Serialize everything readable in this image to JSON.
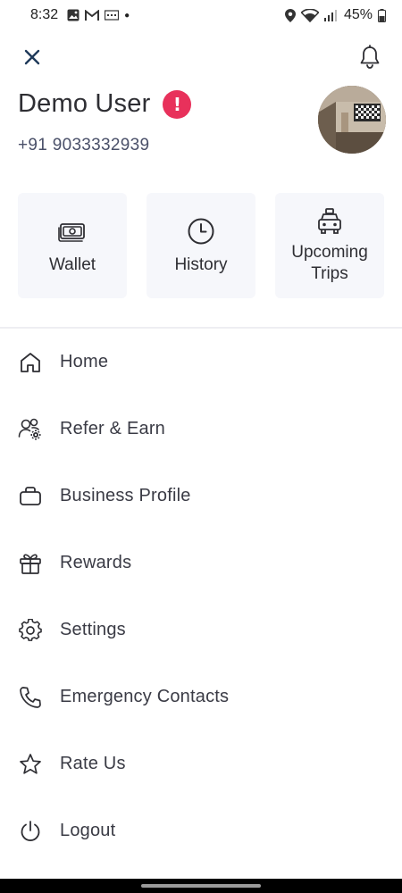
{
  "status_bar": {
    "time": "8:32",
    "battery": "45%",
    "left_icons": [
      "image-icon",
      "gmail-icon",
      "sms-icon",
      "notification-dot"
    ],
    "right_icons": [
      "location-icon",
      "wifi-icon",
      "signal-icon",
      "battery-icon"
    ]
  },
  "header": {
    "close_icon": "close-icon",
    "bell_icon": "bell-icon"
  },
  "profile": {
    "name": "Demo User",
    "alert_symbol": "!",
    "phone": "+91 9033332939",
    "alert_color": "#e8315b"
  },
  "cards": [
    {
      "label": "Wallet",
      "icon": "wallet-icon"
    },
    {
      "label": "History",
      "icon": "clock-icon"
    },
    {
      "label": "Upcoming Trips",
      "icon": "taxi-icon"
    }
  ],
  "menu": {
    "items": [
      {
        "label": "Home",
        "icon": "home-icon"
      },
      {
        "label": "Refer & Earn",
        "icon": "refer-icon"
      },
      {
        "label": "Business Profile",
        "icon": "briefcase-icon"
      },
      {
        "label": "Rewards",
        "icon": "gift-icon"
      },
      {
        "label": "Settings",
        "icon": "gear-icon"
      },
      {
        "label": "Emergency Contacts",
        "icon": "phone-icon"
      },
      {
        "label": "Rate Us",
        "icon": "star-icon"
      },
      {
        "label": "Logout",
        "icon": "power-icon"
      }
    ]
  }
}
